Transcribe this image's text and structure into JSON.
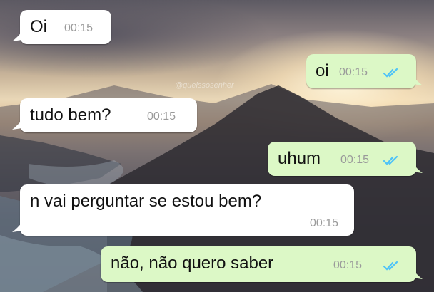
{
  "watermark": "@queissosenher",
  "colors": {
    "incoming_bubble": "#ffffff",
    "outgoing_bubble": "#dcf8c6",
    "timestamp": "#9a9a9a",
    "read_check": "#4fc3f7"
  },
  "messages": [
    {
      "direction": "incoming",
      "text": "Oi",
      "time": "00:15"
    },
    {
      "direction": "outgoing",
      "text": "oi",
      "time": "00:15",
      "status_icon": "double-check-icon"
    },
    {
      "direction": "incoming",
      "text": "tudo bem?",
      "time": "00:15"
    },
    {
      "direction": "outgoing",
      "text": "uhum",
      "time": "00:15",
      "status_icon": "double-check-icon"
    },
    {
      "direction": "incoming",
      "text": "n vai perguntar se estou bem?",
      "time": "00:15"
    },
    {
      "direction": "outgoing",
      "text": "não, não quero saber",
      "time": "00:15",
      "status_icon": "double-check-icon"
    }
  ]
}
